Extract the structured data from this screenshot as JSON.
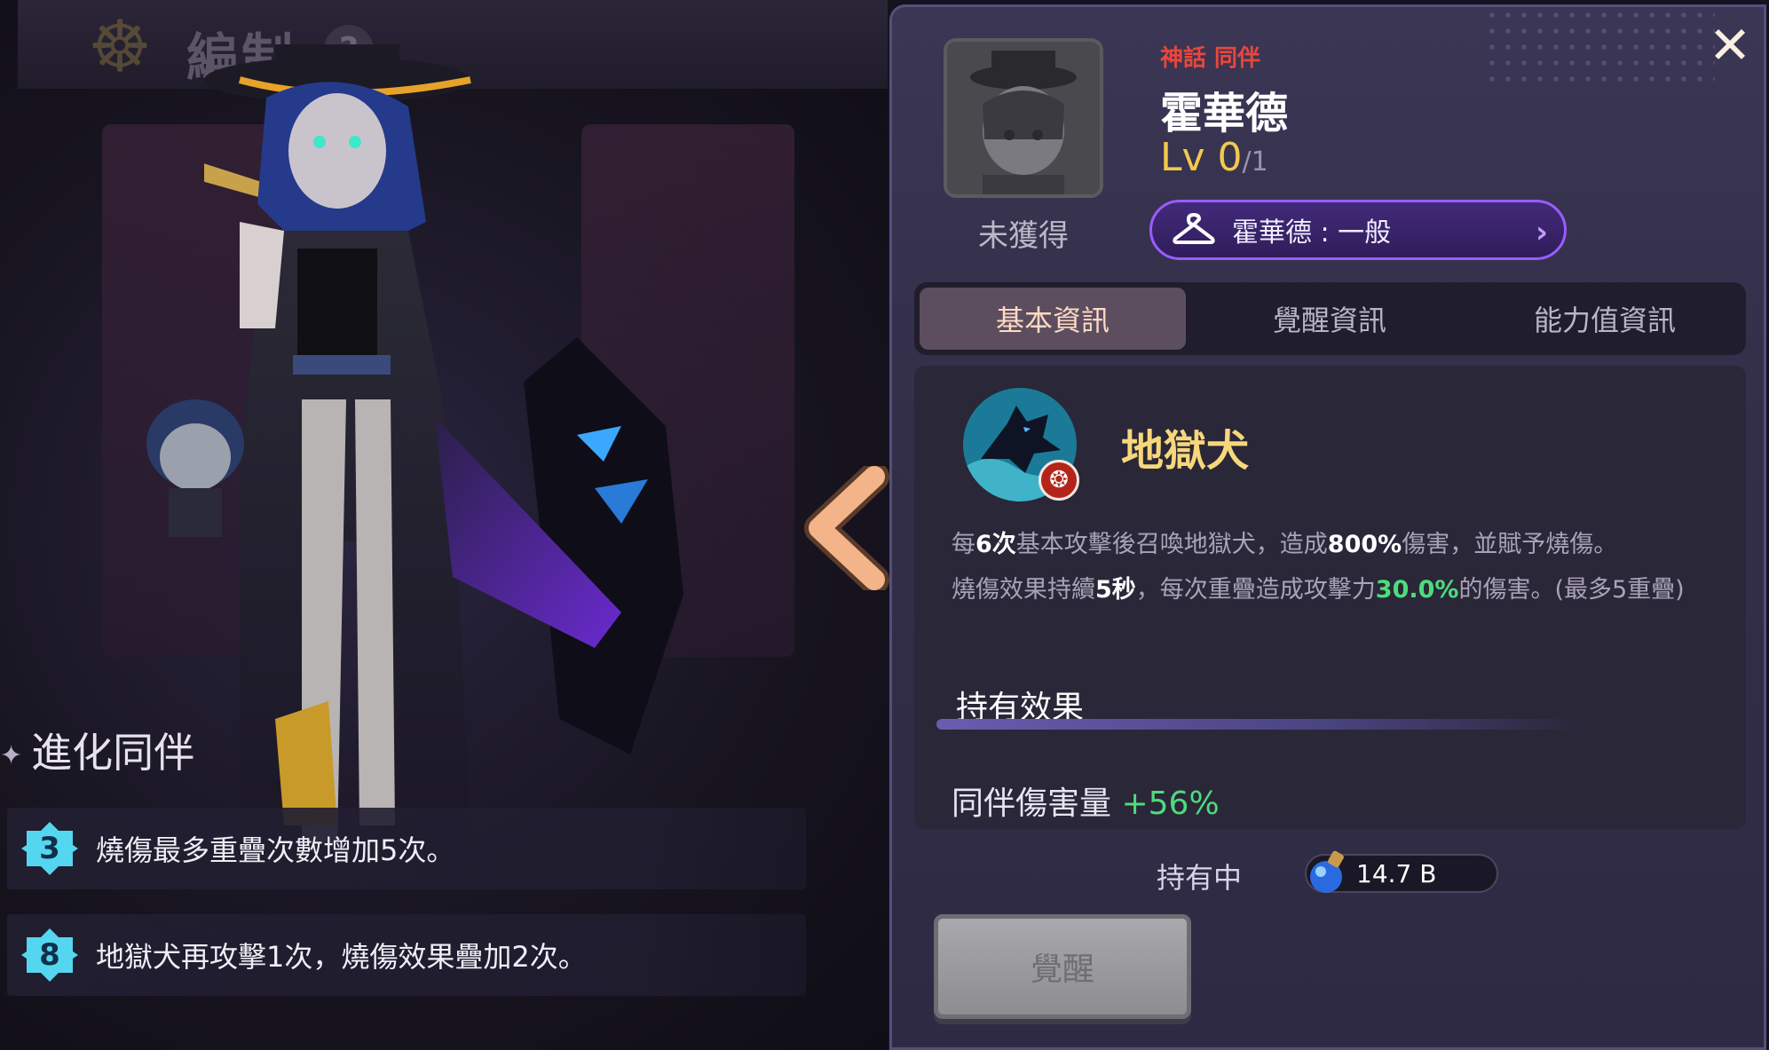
{
  "left": {
    "header_title": "編制",
    "help_label": "?",
    "evolution_title": "進化同伴",
    "evolution": [
      {
        "level": "3",
        "text": "燒傷最多重疊次數增加5次。"
      },
      {
        "level": "8",
        "text": "地獄犬再攻擊1次，燒傷效果疊加2次。"
      }
    ]
  },
  "companion": {
    "rarity": "神話 同伴",
    "name": "霍華德",
    "level": "Lv 0",
    "level_max": "/1",
    "status": "未獲得",
    "skin_label": "霍華德 : 一般"
  },
  "tabs": [
    {
      "label": "基本資訊",
      "active": true
    },
    {
      "label": "覺醒資訊",
      "active": false
    },
    {
      "label": "能力值資訊",
      "active": false
    }
  ],
  "skill": {
    "name": "地獄犬",
    "desc": {
      "a1": "每",
      "b1": "6次",
      "a2": "基本攻擊後召喚地獄犬，造成",
      "b2": "800%",
      "a3": "傷害，並賦予燒傷。",
      "a4": "燒傷效果持續",
      "b3": "5秒",
      "a5": "，每次重疊造成攻擊力",
      "g1": "30.0%",
      "a6": "的傷害。(最多5重疊)"
    }
  },
  "owned_effect": {
    "title": "持有效果",
    "label": "同伴傷害量",
    "value": "+56%"
  },
  "holding": {
    "label": "持有中",
    "amount": "14.7 B"
  },
  "awaken_button": "覺醒",
  "colors": {
    "rarity": "#e8473c",
    "level": "#f2c94c",
    "skill_name": "#f6d77a",
    "positive": "#4ddc7a",
    "skin_border": "#9a5cff"
  }
}
